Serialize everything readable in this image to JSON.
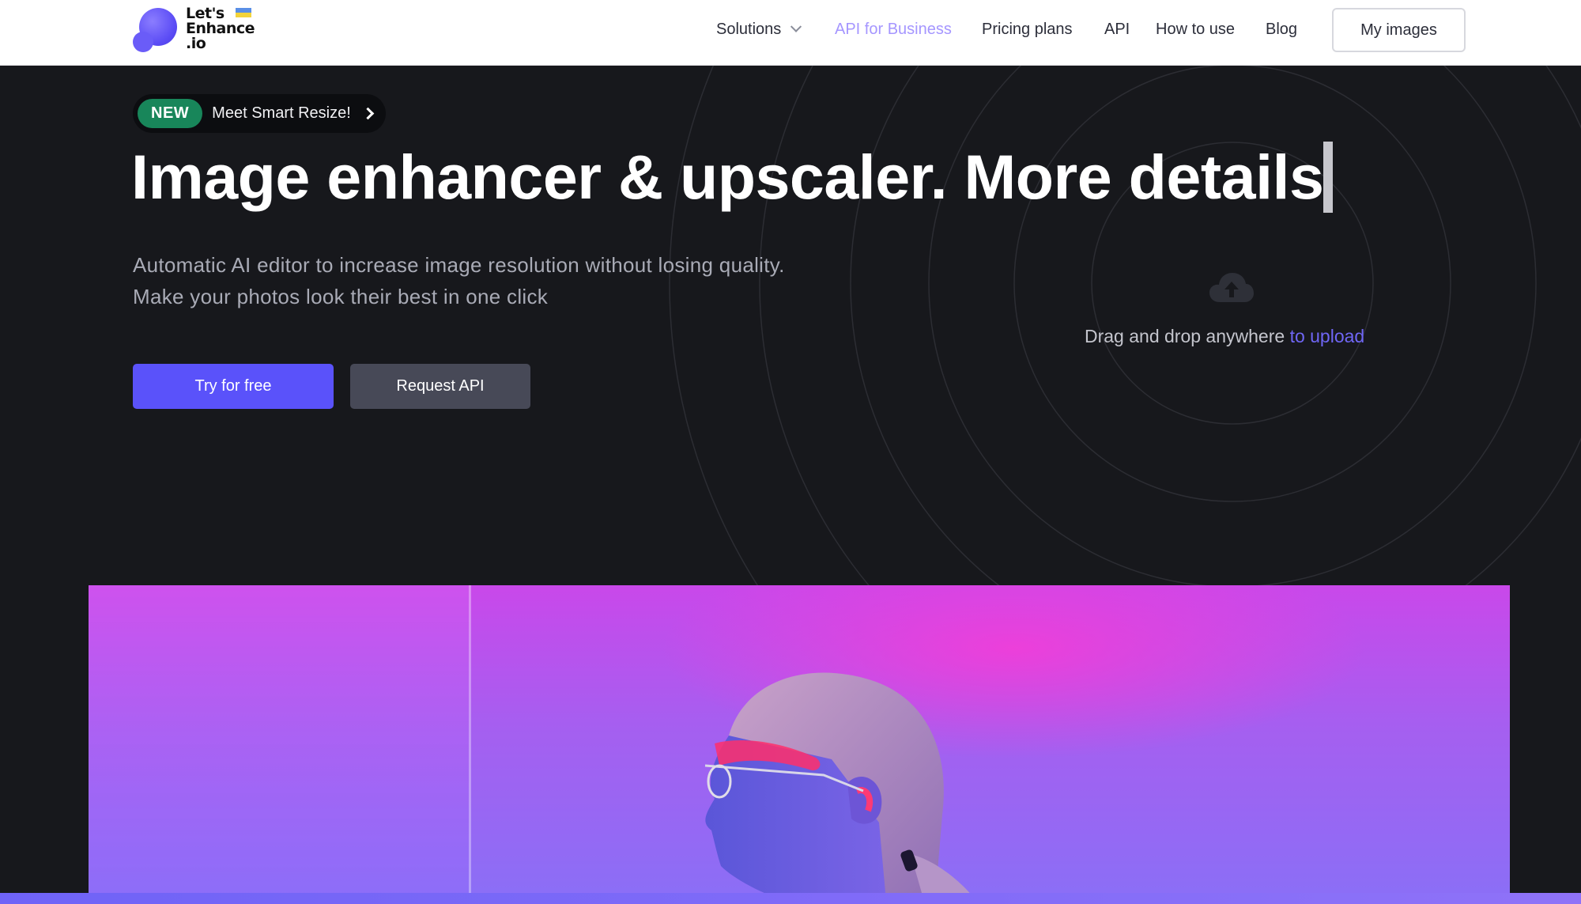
{
  "logo": {
    "line1": "Let's",
    "line2": "Enhance",
    "line3": ".io"
  },
  "nav": {
    "items": [
      {
        "label": "Solutions",
        "has_dropdown": true,
        "active": false
      },
      {
        "label": "API for Business",
        "active": true
      },
      {
        "label": "Pricing plans",
        "active": false
      },
      {
        "label": "API",
        "active": false
      },
      {
        "label": "How to use",
        "active": false
      },
      {
        "label": "Blog",
        "active": false
      }
    ],
    "my_images": "My images"
  },
  "badge": {
    "tag": "NEW",
    "text": "Meet Smart Resize!"
  },
  "hero": {
    "title": "Image enhancer & upscaler. More details",
    "subtitle_line1": "Automatic AI editor to increase image resolution without losing quality.",
    "subtitle_line2": "Make your photos look their best in one click",
    "try_button": "Try for free",
    "api_button": "Request API"
  },
  "upload": {
    "text": "Drag and drop anywhere ",
    "link": "to upload",
    "icon": "cloud-upload-icon"
  },
  "colors": {
    "accent": "#5a52fa",
    "active_nav": "#a596ff",
    "badge_green": "#18865a",
    "hero_bg": "#17181c"
  }
}
